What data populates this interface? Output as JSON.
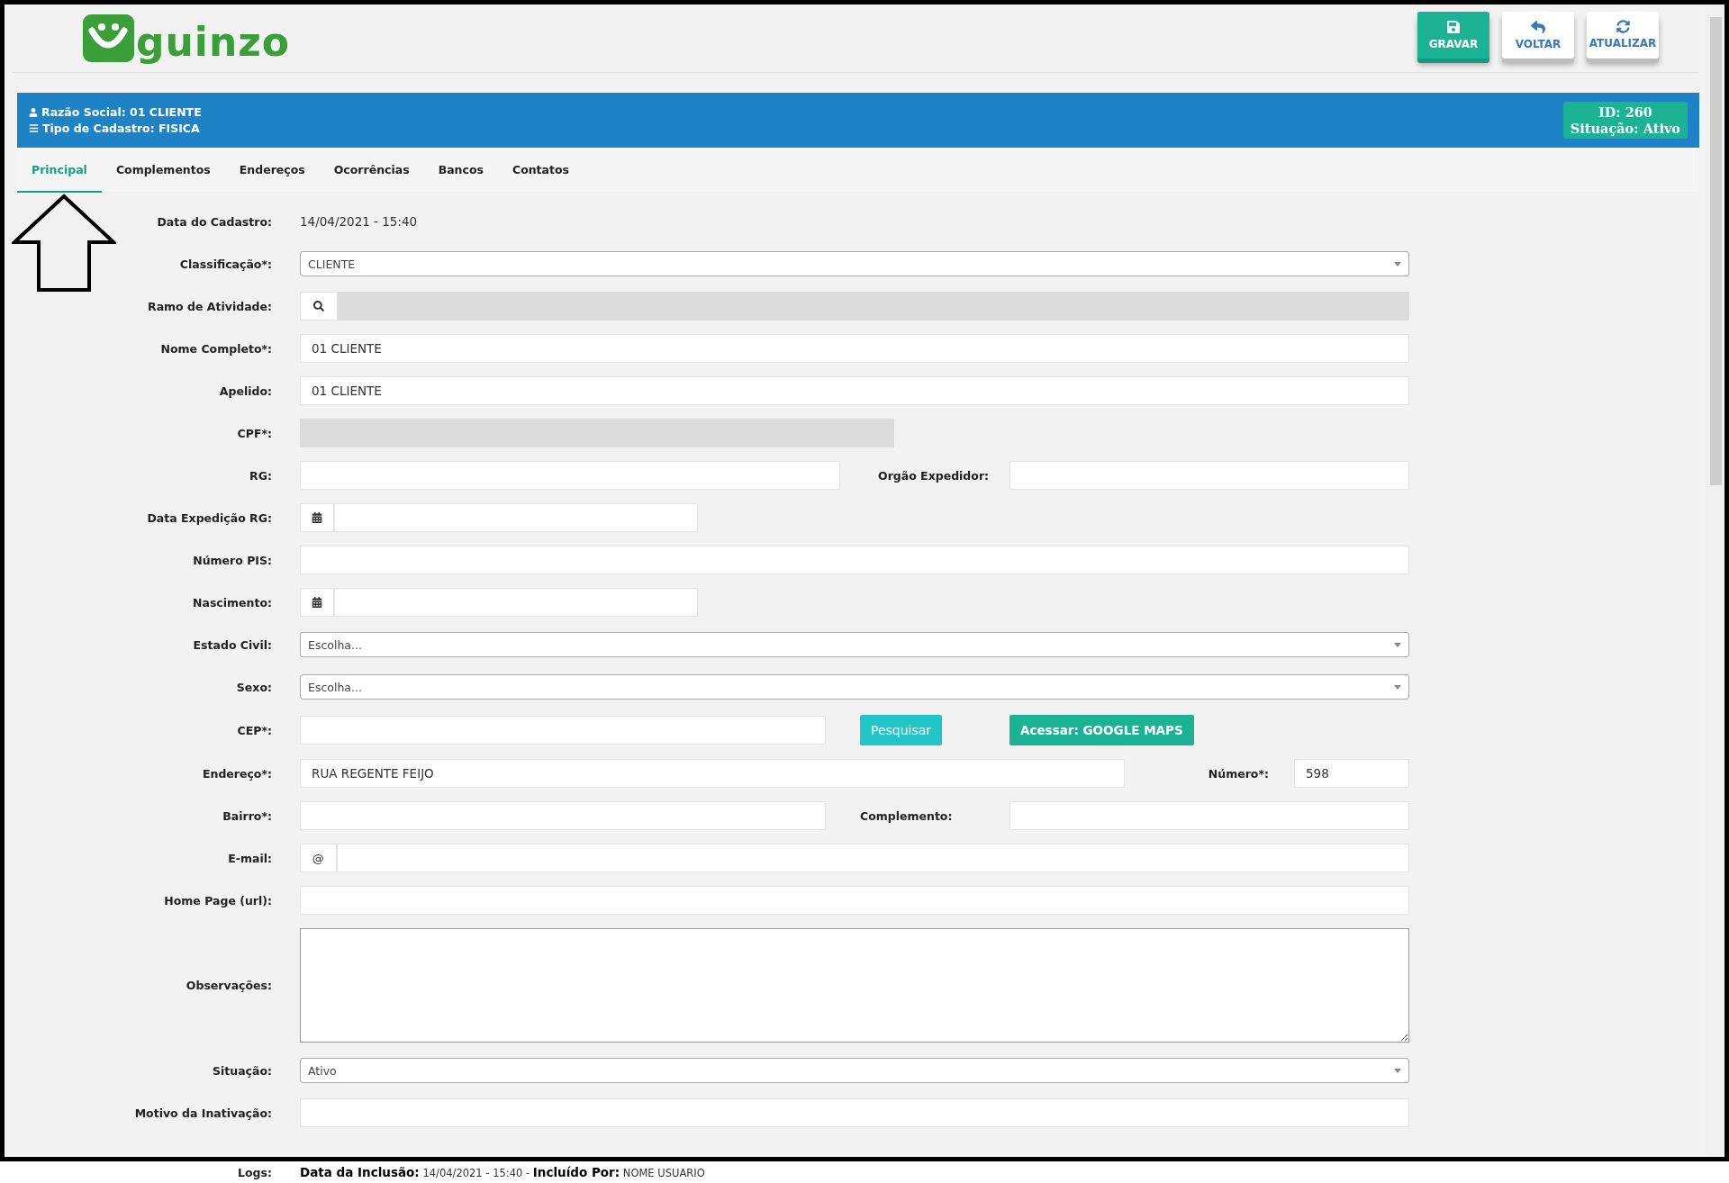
{
  "logo": {
    "text": "guinzo"
  },
  "toolbar": [
    {
      "label": "GRAVAR",
      "kind": "save"
    },
    {
      "label": "VOLTAR",
      "kind": "back"
    },
    {
      "label": "ATUALIZAR",
      "kind": "refresh"
    }
  ],
  "record": {
    "razao_social": "Razão Social: 01 CLIENTE",
    "tipo_cadastro": "Tipo de Cadastro: FISICA",
    "id": "ID: 260",
    "situacao": "Situação: Ativo"
  },
  "tabs": [
    {
      "label": "Principal",
      "selected": true
    },
    {
      "label": "Complementos",
      "selected": false
    },
    {
      "label": "Endereços",
      "selected": false
    },
    {
      "label": "Ocorrências",
      "selected": false
    },
    {
      "label": "Bancos",
      "selected": false
    },
    {
      "label": "Contatos",
      "selected": false
    }
  ],
  "fields": [
    {
      "label": "Data do Cadastro:",
      "kind": "static",
      "value": "14/04/2021 - 15:40"
    },
    {
      "label": "Classificação*:",
      "kind": "select",
      "value": "CLIENTE"
    },
    {
      "label": "Ramo de Atividade:",
      "kind": "search"
    },
    {
      "label": "Nome Completo*:",
      "kind": "text",
      "value": "01 CLIENTE"
    },
    {
      "label": "Apelido:",
      "kind": "text",
      "value": "01 CLIENTE"
    },
    {
      "label": "CPF*:",
      "kind": "masked"
    },
    {
      "label": "RG:",
      "kind": "pair",
      "side_label": "Orgão Expedidor:"
    },
    {
      "label": "Data Expedição RG:",
      "kind": "date"
    },
    {
      "label": "Número PIS:",
      "kind": "text"
    },
    {
      "label": "Nascimento:",
      "kind": "date"
    },
    {
      "label": "Estado Civil:",
      "kind": "select",
      "value": "Escolha..."
    },
    {
      "label": "Sexo:",
      "kind": "select",
      "value": "Escolha..."
    },
    {
      "label": "CEP*:",
      "kind": "cep",
      "buttons": [
        "Pesquisar",
        "Acessar: GOOGLE MAPS"
      ]
    },
    {
      "label": "Endereço*:",
      "kind": "address",
      "value": "RUA REGENTE FEIJO",
      "side_label": "Número*:",
      "side_value": "598"
    },
    {
      "label": "Bairro*:",
      "kind": "pair",
      "side_label": "Complemento:"
    },
    {
      "label": "E-mail:",
      "kind": "email",
      "addon": "@"
    },
    {
      "label": "Home Page (url):",
      "kind": "text"
    },
    {
      "label": "Observações:",
      "kind": "textarea"
    },
    {
      "label": "Situação:",
      "kind": "select",
      "value": "Ativo"
    },
    {
      "label": "Motivo da Inativação:",
      "kind": "text"
    }
  ],
  "logs": {
    "label": "Logs:",
    "text": "**Data da Inclusão:** 14/04/2021 - 15:40 - **Incluído Por:** NOME USUARIO"
  }
}
